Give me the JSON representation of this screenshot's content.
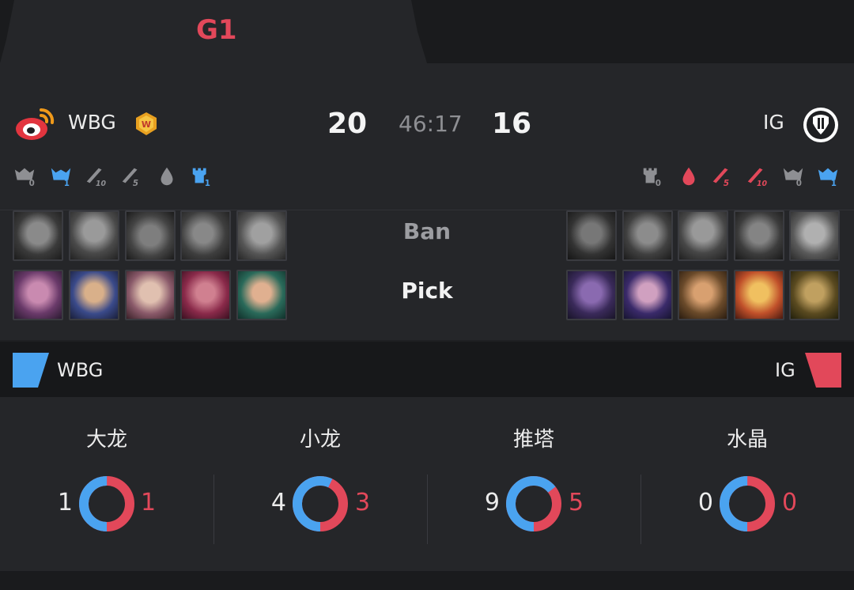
{
  "tabs": [
    {
      "label": "G1",
      "active": true
    },
    {
      "label": "",
      "active": false
    }
  ],
  "match": {
    "left_team": "WBG",
    "right_team": "IG",
    "left_score": "20",
    "right_score": "16",
    "duration": "46:17"
  },
  "objectives": {
    "left": [
      {
        "icon": "baron-icon",
        "value": "0",
        "color": "#8e8f93"
      },
      {
        "icon": "elder-icon",
        "value": "1",
        "color": "#4aa3f0"
      },
      {
        "icon": "ten-kill-sword-icon",
        "value": "10",
        "color": "#8e8f93"
      },
      {
        "icon": "five-kill-sword-icon",
        "value": "5",
        "color": "#8e8f93"
      },
      {
        "icon": "first-blood-icon",
        "value": "",
        "color": "#8e8f93"
      },
      {
        "icon": "first-tower-icon",
        "value": "1",
        "color": "#4aa3f0"
      }
    ],
    "right": [
      {
        "icon": "first-tower-icon",
        "value": "0",
        "color": "#8e8f93"
      },
      {
        "icon": "first-blood-icon",
        "value": "",
        "color": "#e2485a"
      },
      {
        "icon": "five-kill-sword-icon",
        "value": "5",
        "color": "#e2485a"
      },
      {
        "icon": "ten-kill-sword-icon",
        "value": "10",
        "color": "#e2485a"
      },
      {
        "icon": "elder-icon",
        "value": "0",
        "color": "#8e8f93"
      },
      {
        "icon": "baron-icon",
        "value": "1",
        "color": "#4aa3f0"
      }
    ]
  },
  "draft": {
    "ban_label": "Ban",
    "pick_label": "Pick"
  },
  "team_bar": {
    "left": "WBG",
    "right": "IG",
    "left_color": "#4aa3f0",
    "right_color": "#e2485a"
  },
  "stats": [
    {
      "title": "大龙",
      "left": "1",
      "right": "1",
      "left_value": 1,
      "right_value": 1
    },
    {
      "title": "小龙",
      "left": "4",
      "right": "3",
      "left_value": 4,
      "right_value": 3
    },
    {
      "title": "推塔",
      "left": "9",
      "right": "5",
      "left_value": 9,
      "right_value": 5
    },
    {
      "title": "水晶",
      "left": "0",
      "right": "0",
      "left_value": 0,
      "right_value": 0
    }
  ],
  "colors": {
    "blue": "#4aa3f0",
    "red": "#e2485a",
    "background": "#252629"
  }
}
